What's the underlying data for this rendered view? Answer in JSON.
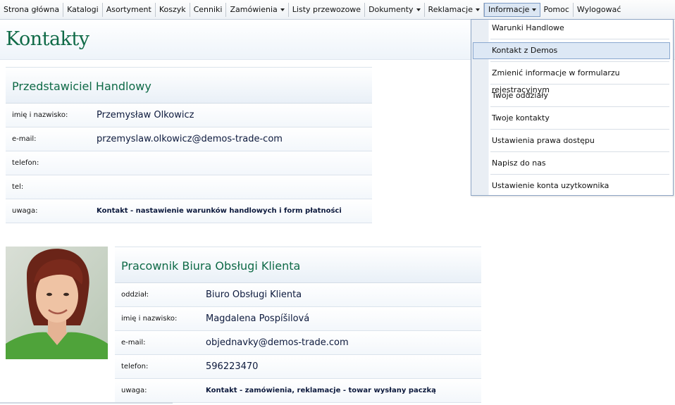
{
  "menu": {
    "items": [
      {
        "label": "Strona główna",
        "caret": false
      },
      {
        "label": "Katalogi",
        "caret": false
      },
      {
        "label": "Asortyment",
        "caret": false
      },
      {
        "label": "Koszyk",
        "caret": false
      },
      {
        "label": "Cenniki",
        "caret": false
      },
      {
        "label": "Zamówienia",
        "caret": true
      },
      {
        "label": "Listy przewozowe",
        "caret": false
      },
      {
        "label": "Dokumenty",
        "caret": true
      },
      {
        "label": "Reklamacje",
        "caret": true
      },
      {
        "label": "Informacje",
        "caret": true,
        "active": true
      },
      {
        "label": "Pomoc",
        "caret": false
      },
      {
        "label": "Wylogować",
        "caret": false
      }
    ]
  },
  "page": {
    "title": "Kontakty"
  },
  "representative": {
    "title": "Przedstawiciel Handlowy",
    "rows": [
      {
        "label": "imię i nazwisko:",
        "value": "Przemysław Olkowicz"
      },
      {
        "label": "e-mail:",
        "value": "przemyslaw.olkowicz@demos-trade-com"
      },
      {
        "label": "telefon:",
        "value": ""
      },
      {
        "label": "tel:",
        "value": ""
      },
      {
        "label": "uwaga:",
        "value": "Kontakt - nastawienie warunków handlowych i form płatności"
      }
    ]
  },
  "office": {
    "title": "Pracownik Biura Obsługi Klienta",
    "rows": [
      {
        "label": "oddział:",
        "value": "Biuro Obsługi Klienta"
      },
      {
        "label": "imię i nazwisko:",
        "value": "Magdalena Pospíšilová"
      },
      {
        "label": "e-mail:",
        "value": "objednavky@demos-trade.com"
      },
      {
        "label": "telefon:",
        "value": "596223470"
      },
      {
        "label": "uwaga:",
        "value": "Kontakt - zamówienia, reklamacje - towar wysłany paczką"
      }
    ]
  },
  "dropdown": {
    "items": [
      {
        "label": "Warunki Handlowe"
      },
      {
        "label": "Kontakt z Demos",
        "active": true
      },
      {
        "label": "Zmienić informacje w formularzu rejestracyjnym"
      },
      {
        "label": "Twoje oddziały"
      },
      {
        "label": "Twoje kontakty"
      },
      {
        "label": "Ustawienia prawa dostępu"
      },
      {
        "label": "Napisz do nas"
      },
      {
        "label": "Ustawienie konta uzytkownika"
      }
    ]
  },
  "colors": {
    "accent_green": "#0f6a47",
    "menu_active": "#dbe6f3"
  }
}
